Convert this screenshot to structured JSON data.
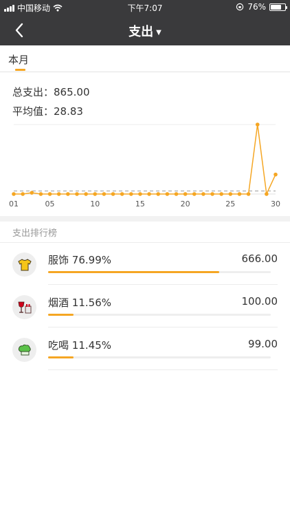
{
  "status_bar": {
    "carrier": "中国移动",
    "time": "下午7:07",
    "battery": "76%",
    "battery_level": 0.76
  },
  "nav": {
    "title": "支出"
  },
  "tabs": [
    {
      "label": "本月",
      "active": true
    }
  ],
  "summary": {
    "total_label": "总支出：",
    "total_value": "865.00",
    "average_label": "平均值：",
    "average_value": "28.83"
  },
  "chart_data": {
    "type": "line",
    "x": [
      1,
      2,
      3,
      4,
      5,
      6,
      7,
      8,
      9,
      10,
      11,
      12,
      13,
      14,
      15,
      16,
      17,
      18,
      19,
      20,
      21,
      22,
      23,
      24,
      25,
      26,
      27,
      28,
      29,
      30
    ],
    "values": [
      0,
      0,
      12,
      0,
      0,
      0,
      0,
      0,
      0,
      0,
      0,
      0,
      0,
      0,
      0,
      0,
      0,
      0,
      0,
      0,
      0,
      0,
      0,
      0,
      0,
      0,
      0,
      666,
      0,
      187
    ],
    "tick_labels": [
      "01",
      "05",
      "10",
      "15",
      "20",
      "25",
      "30"
    ],
    "tick_positions": [
      1,
      5,
      10,
      15,
      20,
      25,
      30
    ],
    "average": 28.83,
    "average_line": "dashed",
    "line_color": "#f5a623",
    "grid": false
  },
  "ranking": {
    "title": "支出排行榜",
    "items": [
      {
        "name": "服饰",
        "percent": "76.99%",
        "amount": "666.00",
        "ratio": 0.7699,
        "icon": "shirt-icon"
      },
      {
        "name": "烟酒",
        "percent": "11.56%",
        "amount": "100.00",
        "ratio": 0.1156,
        "icon": "wine-cigarette-icon"
      },
      {
        "name": "吃喝",
        "percent": "11.45%",
        "amount": "99.00",
        "ratio": 0.1145,
        "icon": "chef-hat-icon"
      }
    ]
  },
  "colors": {
    "accent": "#f5a623",
    "header": "#3a3a3c"
  }
}
